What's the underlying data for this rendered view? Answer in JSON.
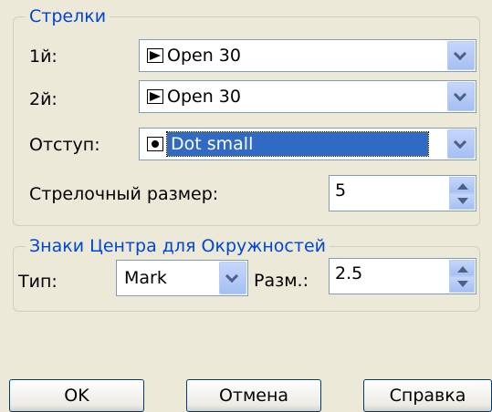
{
  "arrows": {
    "title": "Стрелки",
    "first_label": "1й:",
    "first_value": "Open 30",
    "second_label": "2й:",
    "second_value": "Open 30",
    "offset_label": "Отступ:",
    "offset_value": "Dot small",
    "size_label": "Стрелочный размер:",
    "size_value": "5"
  },
  "center_marks": {
    "title": "Знаки Центра для Окружностей",
    "type_label": "Тип:",
    "type_value": "Mark",
    "size_label": "Разм.:",
    "size_value": "2.5"
  },
  "buttons": {
    "ok": "OK",
    "cancel": "Отмена",
    "help": "Справка"
  },
  "colors": {
    "background": "#ECE9D8",
    "group_title": "#0046D5",
    "selection": "#316AC5"
  }
}
